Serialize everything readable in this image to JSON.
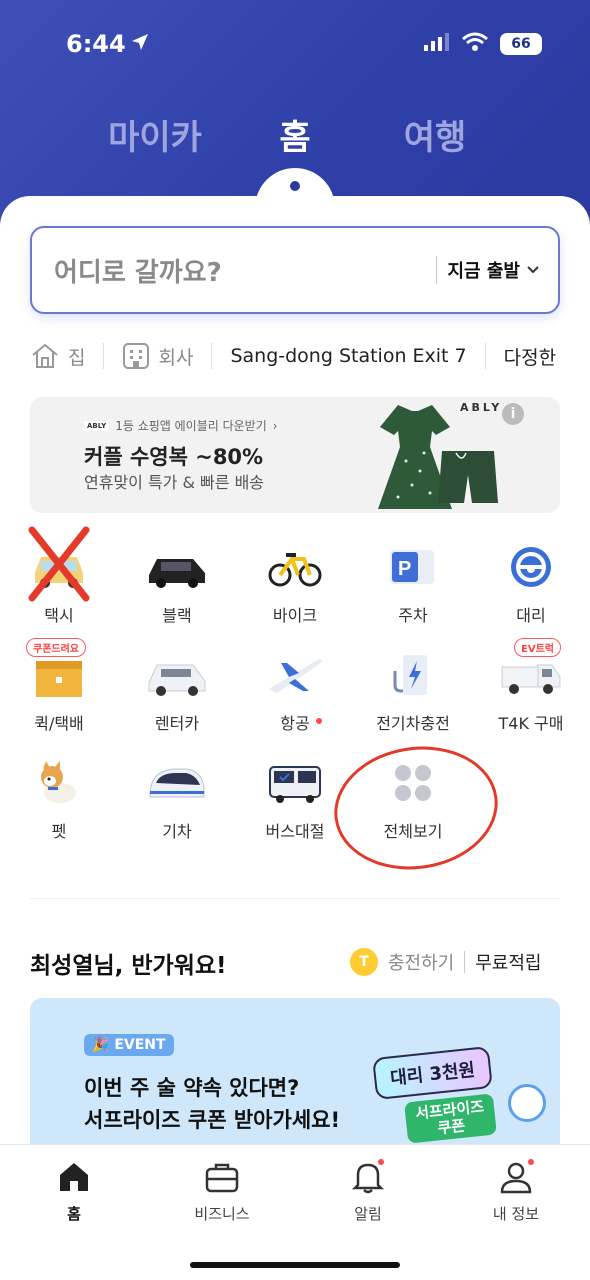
{
  "status": {
    "time": "6:44",
    "battery": "66"
  },
  "top_tabs": [
    {
      "label": "마이카",
      "active": false
    },
    {
      "label": "홈",
      "active": true
    },
    {
      "label": "여행",
      "active": false
    }
  ],
  "search": {
    "placeholder": "어디로 갈까요?",
    "departure": "지금 출발"
  },
  "shortcuts": [
    {
      "label": "집",
      "icon": "home-icon"
    },
    {
      "label": "회사",
      "icon": "building-icon"
    },
    {
      "label": "Sang-dong Station Exit 7"
    },
    {
      "label": "다정한"
    }
  ],
  "banner": {
    "brand_mini": "ABLY",
    "tag": "1등 쇼핑앱 에이블리 다운받기",
    "headline": "커플 수영복 ~80%",
    "subline": "연휴맞이 특가 & 빠른 배송",
    "brand": "ABLY",
    "info": "i"
  },
  "services": [
    {
      "label": "택시",
      "icon": "taxi-icon"
    },
    {
      "label": "블랙",
      "icon": "black-car-icon"
    },
    {
      "label": "바이크",
      "icon": "bike-icon"
    },
    {
      "label": "주차",
      "icon": "parking-icon"
    },
    {
      "label": "대리",
      "icon": "steering-wheel-icon"
    },
    {
      "label": "퀵/택배",
      "icon": "box-icon",
      "pill": "쿠폰드려요"
    },
    {
      "label": "렌터카",
      "icon": "rental-car-icon"
    },
    {
      "label": "항공",
      "icon": "airplane-icon",
      "dot": true
    },
    {
      "label": "전기차충전",
      "icon": "ev-charger-icon"
    },
    {
      "label": "T4K 구매",
      "icon": "truck-icon",
      "pill": "EV트럭"
    },
    {
      "label": "펫",
      "icon": "dog-icon"
    },
    {
      "label": "기차",
      "icon": "train-icon"
    },
    {
      "label": "버스대절",
      "icon": "bus-icon"
    },
    {
      "label": "전체보기",
      "icon": "grid-dots-icon"
    }
  ],
  "greeting": {
    "text": "최성열님, 반가워요!",
    "coin": "T",
    "charge": "충전하기",
    "free": "무료적립"
  },
  "event": {
    "badge": "EVENT",
    "line1": "이번 주 술 약속 있다면?",
    "line2": "서프라이즈 쿠폰 받아가세요!",
    "coupon_top": "대리 3천원",
    "coupon_bottom_1": "서프라이즈",
    "coupon_bottom_2": "쿠폰"
  },
  "bottom_nav": [
    {
      "label": "홈",
      "icon": "home-icon",
      "active": true
    },
    {
      "label": "비즈니스",
      "icon": "briefcase-icon"
    },
    {
      "label": "알림",
      "icon": "bell-icon",
      "dot": true
    },
    {
      "label": "내 정보",
      "icon": "person-icon",
      "dot": true
    }
  ],
  "colors": {
    "primary": "#2f3fa8",
    "accent_red": "#ff4a4a",
    "coin": "#ffcc33"
  }
}
